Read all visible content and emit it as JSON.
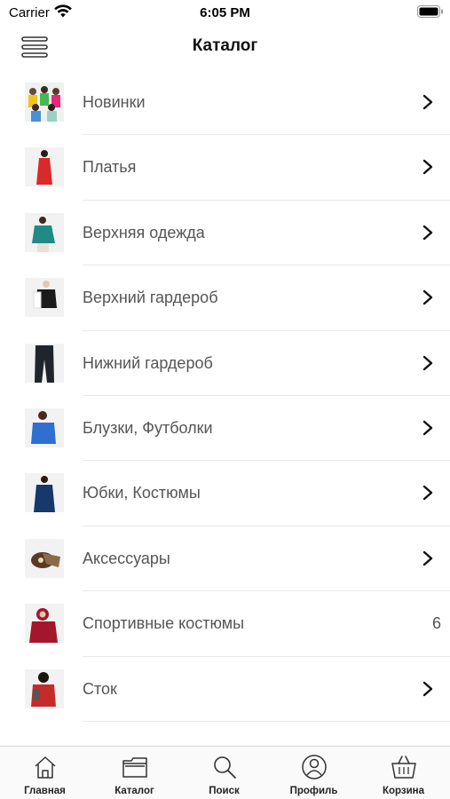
{
  "status_bar": {
    "carrier": "Carrier",
    "time": "6:05 PM",
    "wifi_icon": "wifi-icon",
    "battery_icon": "battery-icon"
  },
  "nav": {
    "title": "Каталог",
    "menu_icon": "hamburger-menu-icon"
  },
  "catalog": {
    "items": [
      {
        "label": "Новинки",
        "trailing": "chevron",
        "thumb_color": "#3bb0a0"
      },
      {
        "label": "Платья",
        "trailing": "chevron",
        "thumb_color": "#d82a2a"
      },
      {
        "label": "Верхняя одежда",
        "trailing": "chevron",
        "thumb_color": "#1f8a86"
      },
      {
        "label": "Верхний гардероб",
        "trailing": "chevron",
        "thumb_color": "#1b1b1b"
      },
      {
        "label": "Нижний гардероб",
        "trailing": "chevron",
        "thumb_color": "#20252b"
      },
      {
        "label": "Блузки, Футболки",
        "trailing": "chevron",
        "thumb_color": "#2f6fd0"
      },
      {
        "label": "Юбки, Костюмы",
        "trailing": "chevron",
        "thumb_color": "#16386a"
      },
      {
        "label": "Аксессуары",
        "trailing": "chevron",
        "thumb_color": "#5a3a22"
      },
      {
        "label": "Спортивные костюмы",
        "trailing": "count",
        "count": "6",
        "thumb_color": "#a3162b"
      },
      {
        "label": "Сток",
        "trailing": "chevron",
        "thumb_color": "#c52b2b"
      }
    ]
  },
  "tabs": [
    {
      "label": "Главная",
      "icon": "home-icon"
    },
    {
      "label": "Каталог",
      "icon": "folder-icon"
    },
    {
      "label": "Поиск",
      "icon": "search-icon"
    },
    {
      "label": "Профиль",
      "icon": "profile-icon"
    },
    {
      "label": "Корзина",
      "icon": "basket-icon"
    }
  ]
}
